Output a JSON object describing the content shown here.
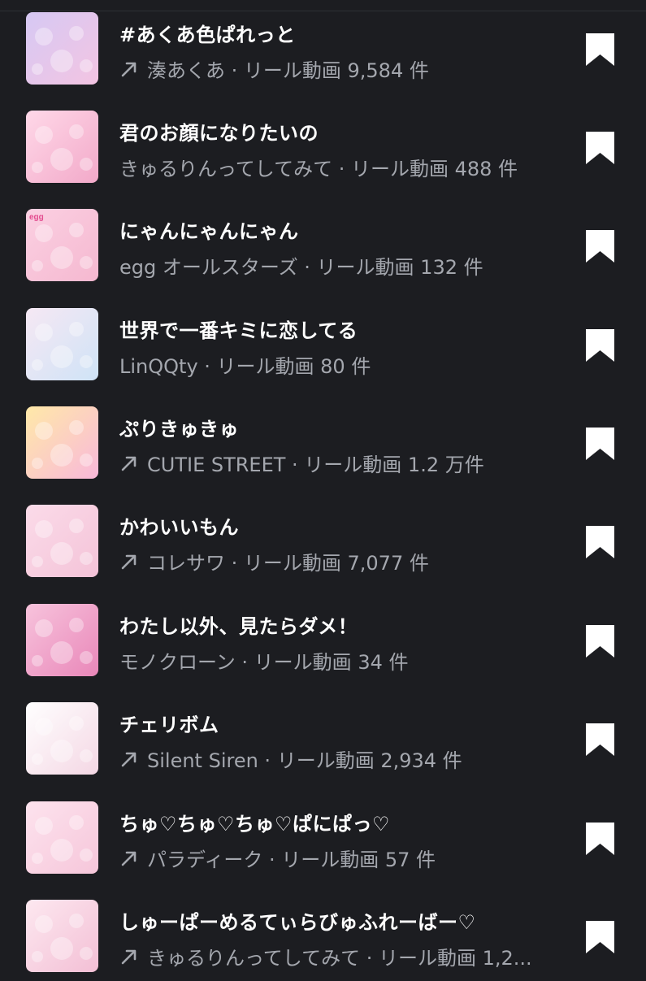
{
  "colors": {
    "background": "#1c1d21",
    "title": "#ffffff",
    "subtitle": "#a4a7ae",
    "bookmark": "#ffffff"
  },
  "items": [
    {
      "title": "#あくあ色ぱれっと",
      "trending": true,
      "subtitle": "湊あくあ · リール動画 9,584 件",
      "thumb_colors": [
        "#d6c9f4",
        "#f3c4e2"
      ],
      "thumb_label": ""
    },
    {
      "title": "君のお顔になりたいの",
      "trending": false,
      "subtitle": "きゅるりんってしてみて · リール動画 488 件",
      "thumb_colors": [
        "#ffd8e8",
        "#f2a9c9"
      ],
      "thumb_label": ""
    },
    {
      "title": "にゃんにゃんにゃん",
      "trending": false,
      "subtitle": "egg オールスターズ · リール動画 132 件",
      "thumb_colors": [
        "#fbd0e2",
        "#f5b8d0"
      ],
      "thumb_label": "egg"
    },
    {
      "title": "世界で一番キミに恋してる",
      "trending": false,
      "subtitle": "LinQQty · リール動画 80 件",
      "thumb_colors": [
        "#f6e8f4",
        "#cfe3f6"
      ],
      "thumb_label": ""
    },
    {
      "title": "ぷりきゅきゅ",
      "trending": true,
      "subtitle": "CUTIE STREET · リール動画 1.2 万件",
      "thumb_colors": [
        "#ffe9a8",
        "#f9b8da"
      ],
      "thumb_label": ""
    },
    {
      "title": "かわいいもん",
      "trending": true,
      "subtitle": "コレサワ · リール動画 7,077 件",
      "thumb_colors": [
        "#fbdbe9",
        "#f4c3d8"
      ],
      "thumb_label": ""
    },
    {
      "title": "わたし以外、見たらダメ！",
      "trending": false,
      "subtitle": "モノクローン · リール動画 34 件",
      "thumb_colors": [
        "#f7c3dc",
        "#e987b9"
      ],
      "thumb_label": ""
    },
    {
      "title": "チェリボム",
      "trending": true,
      "subtitle": "Silent Siren · リール動画 2,934 件",
      "thumb_colors": [
        "#ffffff",
        "#f4d7e4"
      ],
      "thumb_label": ""
    },
    {
      "title": "ちゅ♡ちゅ♡ちゅ♡ぱにぱっ♡",
      "trending": true,
      "subtitle": "パラディーク · リール動画 57 件",
      "thumb_colors": [
        "#fde3ee",
        "#f6c6da"
      ],
      "thumb_label": ""
    },
    {
      "title": "しゅーぱーめるてぃらびゅふれーばー♡",
      "trending": true,
      "subtitle": "きゅるりんってしてみて · リール動画 1,2...",
      "thumb_colors": [
        "#fde8f0",
        "#f3bfd5"
      ],
      "thumb_label": ""
    }
  ],
  "icons": {
    "trending": "arrow-up-right-icon",
    "save": "bookmark-icon"
  }
}
